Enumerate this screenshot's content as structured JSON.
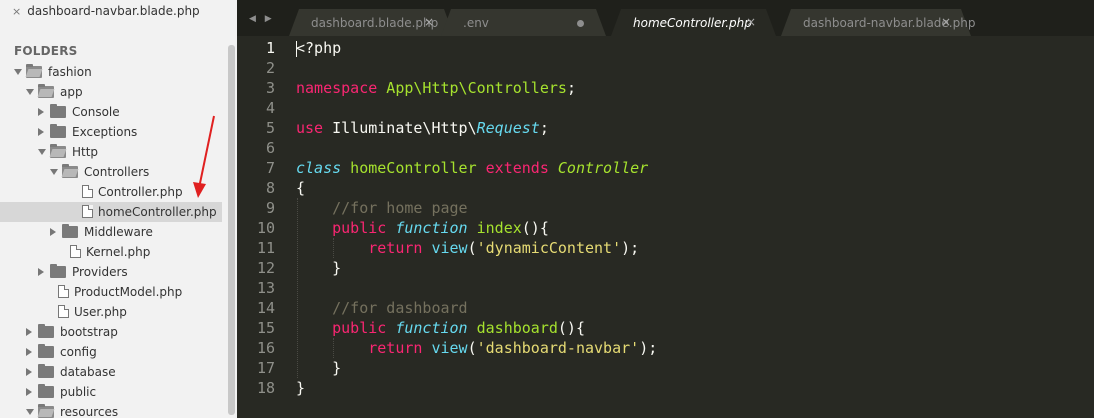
{
  "sidebar": {
    "open_file": {
      "close": "×",
      "name": "dashboard-navbar.blade.php"
    },
    "folders_heading": "FOLDERS",
    "tree": [
      {
        "label": "fashion",
        "kind": "folder",
        "open": true,
        "depth": 0
      },
      {
        "label": "app",
        "kind": "folder",
        "open": true,
        "depth": 1
      },
      {
        "label": "Console",
        "kind": "folder",
        "open": false,
        "depth": 2
      },
      {
        "label": "Exceptions",
        "kind": "folder",
        "open": false,
        "depth": 2
      },
      {
        "label": "Http",
        "kind": "folder",
        "open": true,
        "depth": 2
      },
      {
        "label": "Controllers",
        "kind": "folder",
        "open": true,
        "depth": 3
      },
      {
        "label": "Controller.php",
        "kind": "file",
        "depth": 4
      },
      {
        "label": "homeController.php",
        "kind": "file",
        "depth": 4,
        "selected": true
      },
      {
        "label": "Middleware",
        "kind": "folder",
        "open": false,
        "depth": 3
      },
      {
        "label": "Kernel.php",
        "kind": "file",
        "depth": 3
      },
      {
        "label": "Providers",
        "kind": "folder",
        "open": false,
        "depth": 2
      },
      {
        "label": "ProductModel.php",
        "kind": "file",
        "depth": 2
      },
      {
        "label": "User.php",
        "kind": "file",
        "depth": 2
      },
      {
        "label": "bootstrap",
        "kind": "folder",
        "open": false,
        "depth": 1
      },
      {
        "label": "config",
        "kind": "folder",
        "open": false,
        "depth": 1
      },
      {
        "label": "database",
        "kind": "folder",
        "open": false,
        "depth": 1
      },
      {
        "label": "public",
        "kind": "folder",
        "open": false,
        "depth": 1
      },
      {
        "label": "resources",
        "kind": "folder",
        "open": true,
        "depth": 1
      }
    ]
  },
  "annotation": {
    "color": "#e02020"
  },
  "editor": {
    "nav_arrows": "◀ ▶",
    "tabs": [
      {
        "label": "dashboard.blade.php",
        "active": false,
        "state": "close",
        "close": "×"
      },
      {
        "label": ".env",
        "active": false,
        "state": "dirty"
      },
      {
        "label": "homeController.php",
        "active": true,
        "state": "close",
        "close": "×"
      },
      {
        "label": "dashboard-navbar.blade.php",
        "active": false,
        "state": "close",
        "close": "×"
      }
    ],
    "current_line": 1,
    "lines": [
      [
        {
          "t": "<?php",
          "c": ""
        }
      ],
      [],
      [
        {
          "t": "namespace",
          "c": "kw"
        },
        {
          "t": " App\\Http\\Controllers",
          "c": "ty"
        },
        {
          "t": ";",
          "c": ""
        }
      ],
      [],
      [
        {
          "t": "use",
          "c": "kw"
        },
        {
          "t": " Illuminate\\Http\\",
          "c": ""
        },
        {
          "t": "Request",
          "c": "bi-it"
        },
        {
          "t": ";",
          "c": ""
        }
      ],
      [],
      [
        {
          "t": "class",
          "c": "kw-it"
        },
        {
          "t": " homeController ",
          "c": "ty"
        },
        {
          "t": "extends",
          "c": "kw"
        },
        {
          "t": " ",
          "c": ""
        },
        {
          "t": "Controller",
          "c": "ty-it"
        }
      ],
      [
        {
          "t": "{",
          "c": ""
        }
      ],
      [
        {
          "t": "    //for home page",
          "c": "cm"
        }
      ],
      [
        {
          "t": "    ",
          "c": ""
        },
        {
          "t": "public",
          "c": "kw"
        },
        {
          "t": " ",
          "c": ""
        },
        {
          "t": "function",
          "c": "kw-it"
        },
        {
          "t": " ",
          "c": ""
        },
        {
          "t": "index",
          "c": "fn"
        },
        {
          "t": "(){",
          "c": ""
        }
      ],
      [
        {
          "t": "        ",
          "c": ""
        },
        {
          "t": "return",
          "c": "kw"
        },
        {
          "t": " ",
          "c": ""
        },
        {
          "t": "view",
          "c": "bi"
        },
        {
          "t": "(",
          "c": ""
        },
        {
          "t": "'dynamicContent'",
          "c": "st"
        },
        {
          "t": ");",
          "c": ""
        }
      ],
      [
        {
          "t": "    }",
          "c": ""
        }
      ],
      [],
      [
        {
          "t": "    //for dashboard",
          "c": "cm"
        }
      ],
      [
        {
          "t": "    ",
          "c": ""
        },
        {
          "t": "public",
          "c": "kw"
        },
        {
          "t": " ",
          "c": ""
        },
        {
          "t": "function",
          "c": "kw-it"
        },
        {
          "t": " ",
          "c": ""
        },
        {
          "t": "dashboard",
          "c": "fn"
        },
        {
          "t": "(){",
          "c": ""
        }
      ],
      [
        {
          "t": "        ",
          "c": ""
        },
        {
          "t": "return",
          "c": "kw"
        },
        {
          "t": " ",
          "c": ""
        },
        {
          "t": "view",
          "c": "bi"
        },
        {
          "t": "(",
          "c": ""
        },
        {
          "t": "'dashboard-navbar'",
          "c": "st"
        },
        {
          "t": ");",
          "c": ""
        }
      ],
      [
        {
          "t": "    }",
          "c": ""
        }
      ],
      [
        {
          "t": "}",
          "c": ""
        }
      ]
    ]
  },
  "colors": {
    "editor_bg": "#282923",
    "tabbar_bg": "#1f201b",
    "sidebar_bg": "#f2f2f2",
    "selected_row": "#d7d7d7",
    "keyword": "#f92672",
    "type": "#a6e22e",
    "string": "#e6db74",
    "comment": "#75715e",
    "builtin": "#66d9ef"
  }
}
